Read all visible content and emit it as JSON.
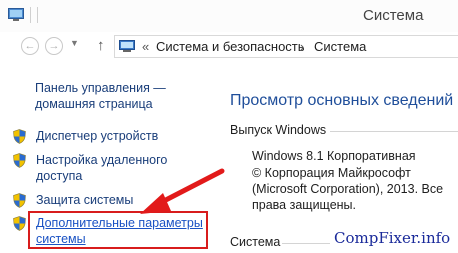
{
  "window": {
    "title": "Система"
  },
  "address_bar": {
    "separator": "«",
    "crumbs": [
      "Система и безопасность",
      "Система"
    ],
    "crumb_separator": "›"
  },
  "left_pane": {
    "home_link": [
      "Панель управления —",
      "домашняя страница"
    ],
    "items": [
      {
        "label": [
          "Диспетчер устройств"
        ],
        "icon": "shield-icon"
      },
      {
        "label": [
          "Настройка удаленного",
          "доступа"
        ],
        "icon": "shield-icon"
      },
      {
        "label": [
          "Защита системы"
        ],
        "icon": "shield-icon"
      },
      {
        "label": [
          "Дополнительные параметры",
          "системы"
        ],
        "icon": "shield-icon",
        "highlighted": true
      }
    ]
  },
  "main": {
    "title": "Просмотр основных сведений о",
    "windows_edition_heading": "Выпуск Windows",
    "edition": "Windows 8.1 Корпоративная",
    "copyright": [
      "© Корпорация Майкрософт",
      "(Microsoft Corporation), 2013. Все",
      "права защищены."
    ],
    "system_heading": "Система"
  },
  "watermark": "CompFixer.info",
  "colors": {
    "link": "#1a3e7a",
    "highlight": "#d81c1c",
    "title": "#1f4e9a"
  }
}
